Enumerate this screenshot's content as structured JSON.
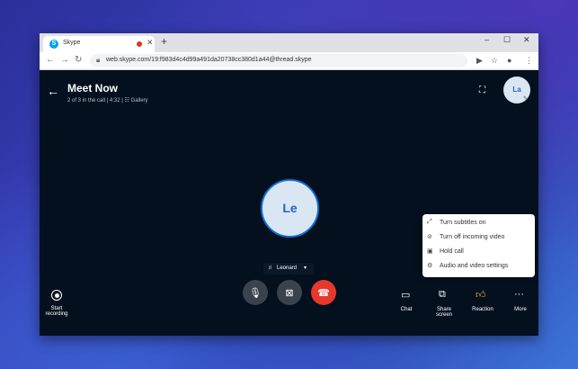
{
  "browser": {
    "tab_title": "Skype",
    "tab_icon": "S",
    "tab_close": "✕",
    "new_tab": "+",
    "url": "web.skype.com/19:f983d4c4d99a491da20738cc380d1a44@thread.skype",
    "window_controls": [
      "–",
      "☐",
      "✕"
    ]
  },
  "call": {
    "title": "Meet Now",
    "subtitle": "2 of 3 in the call | 4:32 | ☷ Gallery",
    "self_avatar_initials": "La",
    "participant_initials": "Le",
    "participant_name": "Leonard"
  },
  "menu": {
    "items": [
      {
        "label": "Turn subtitles on",
        "icon": "subtitles-icon"
      },
      {
        "label": "Turn off incoming video",
        "icon": "video-off-icon"
      },
      {
        "label": "Hold call",
        "icon": "hold-icon"
      },
      {
        "label": "Audio and video settings",
        "icon": "gear-icon"
      }
    ]
  },
  "controls": {
    "start_recording_line1": "Start",
    "start_recording_line2": "recording",
    "chat": "Chat",
    "share_line1": "Share",
    "share_line2": "screen",
    "reaction": "Reaction",
    "more": "More"
  },
  "colors": {
    "app_background": "#05101f",
    "end_call_red": "#e8372c",
    "avatar_blue": "#1d68c4"
  }
}
